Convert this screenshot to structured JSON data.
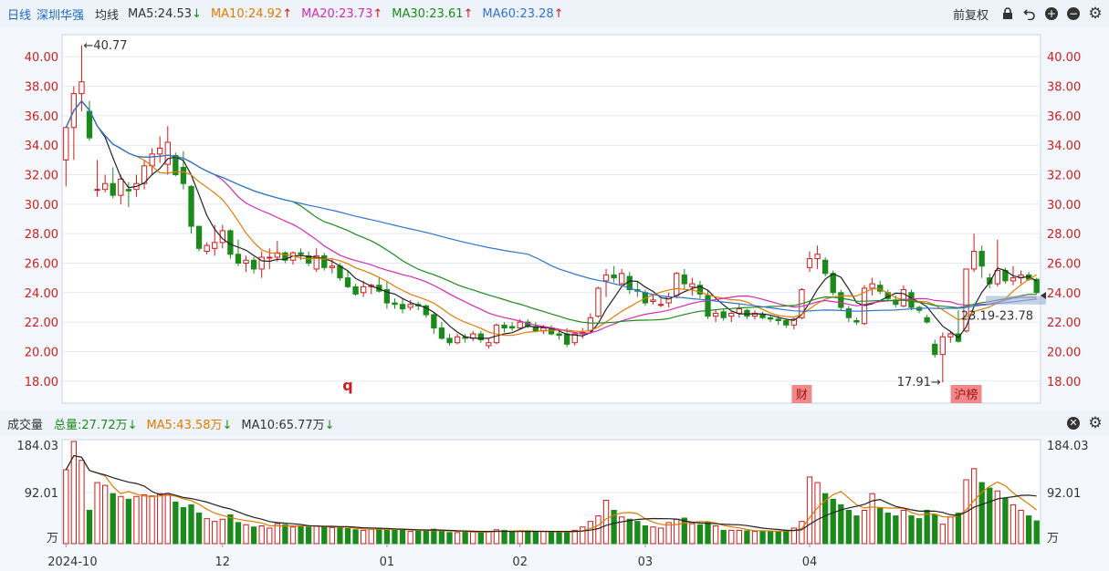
{
  "header": {
    "period": "日线",
    "stock_name": "深圳华强",
    "avg_label": "均线",
    "ma": [
      {
        "text": "MA5:24.53",
        "arrow": "↓",
        "color": "#333333",
        "arrow_color": "#1b8a1b"
      },
      {
        "text": "MA10:24.92",
        "arrow": "↑",
        "color": "#e07b00",
        "arrow_color": "#d11a1a"
      },
      {
        "text": "MA20:23.73",
        "arrow": "↑",
        "color": "#d42bb0",
        "arrow_color": "#d11a1a"
      },
      {
        "text": "MA30:23.61",
        "arrow": "↑",
        "color": "#1b8a1b",
        "arrow_color": "#d11a1a"
      },
      {
        "text": "MA60:23.28",
        "arrow": "↑",
        "color": "#2f74d0",
        "arrow_color": "#d11a1a"
      }
    ],
    "adjust": "前复权",
    "icons": [
      "lock-icon",
      "undo-icon",
      "zoom-in-icon",
      "zoom-out-icon",
      "settings-icon"
    ]
  },
  "price_chart": {
    "y_ticks": [
      "40.00",
      "38.00",
      "36.00",
      "34.00",
      "32.00",
      "30.00",
      "28.00",
      "26.00",
      "24.00",
      "22.00",
      "20.00",
      "18.00"
    ],
    "high_label": "←40.77",
    "low_label": "17.91→",
    "range_label": "23.19-23.78",
    "markers": [
      {
        "text": "q",
        "style": "plain"
      },
      {
        "text": "财",
        "style": "badge"
      },
      {
        "text": "沪榜",
        "style": "badge"
      }
    ]
  },
  "volume_bar": {
    "title": "成交量",
    "total": "总量:27.72万",
    "total_arrow": "↓",
    "ma5": "MA5:43.58万",
    "ma5_arrow": "↓",
    "ma10": "MA10:65.77万",
    "ma10_arrow": "↓",
    "icons": [
      "close-icon",
      "settings-icon"
    ]
  },
  "volume_chart": {
    "y_ticks": [
      "184.03",
      "92.01",
      "万"
    ],
    "x_ticks": [
      "2024-10",
      "12",
      "01",
      "02",
      "03",
      "04"
    ]
  },
  "chart_data": {
    "type": "candlestick",
    "y_range": [
      16.5,
      41.5
    ],
    "volume_range": [
      0,
      184.03
    ],
    "candles": [
      [
        33.0,
        35.2,
        31.2,
        35.2,
        133
      ],
      [
        35.2,
        38.0,
        33.0,
        37.5,
        184
      ],
      [
        37.5,
        40.77,
        36.3,
        38.3,
        150
      ],
      [
        36.3,
        37.0,
        34.3,
        34.5,
        60
      ],
      [
        31.0,
        33.0,
        30.5,
        31.0,
        110
      ],
      [
        31.0,
        32.0,
        30.8,
        31.4,
        105
      ],
      [
        31.4,
        32.5,
        30.4,
        30.6,
        90
      ],
      [
        30.6,
        32.0,
        30.0,
        31.7,
        85
      ],
      [
        31.0,
        31.5,
        29.8,
        30.9,
        80
      ],
      [
        31.0,
        32.0,
        30.5,
        31.4,
        85
      ],
      [
        31.4,
        33.0,
        31.0,
        32.6,
        88
      ],
      [
        32.6,
        33.8,
        32.0,
        33.4,
        86
      ],
      [
        33.4,
        34.6,
        32.8,
        33.8,
        90
      ],
      [
        32.7,
        35.3,
        32.0,
        34.2,
        88
      ],
      [
        33.3,
        33.5,
        31.9,
        32.0,
        75
      ],
      [
        32.5,
        33.6,
        31.0,
        31.4,
        65
      ],
      [
        31.2,
        31.3,
        28.0,
        28.5,
        70
      ],
      [
        28.5,
        28.5,
        26.8,
        27.0,
        55
      ],
      [
        26.8,
        27.4,
        26.6,
        27.2,
        45
      ],
      [
        27.0,
        28.6,
        26.5,
        27.4,
        40
      ],
      [
        27.4,
        28.6,
        27.0,
        28.2,
        44
      ],
      [
        28.2,
        28.3,
        26.3,
        26.6,
        52
      ],
      [
        26.6,
        27.6,
        25.8,
        26.0,
        38
      ],
      [
        26.0,
        26.5,
        25.4,
        26.2,
        34
      ],
      [
        26.2,
        26.4,
        25.3,
        25.6,
        30
      ],
      [
        25.6,
        26.8,
        25.0,
        26.4,
        32
      ],
      [
        26.4,
        27.0,
        25.6,
        26.4,
        28
      ],
      [
        26.4,
        27.5,
        26.1,
        26.7,
        36
      ],
      [
        26.7,
        26.8,
        26.0,
        26.2,
        34
      ],
      [
        26.2,
        26.8,
        25.9,
        26.7,
        30
      ],
      [
        26.7,
        27.0,
        26.2,
        26.6,
        31
      ],
      [
        26.5,
        26.8,
        25.8,
        26.0,
        30
      ],
      [
        25.6,
        27.0,
        25.4,
        26.5,
        32
      ],
      [
        26.5,
        26.7,
        25.5,
        25.7,
        30
      ],
      [
        25.7,
        26.3,
        25.3,
        25.8,
        29
      ],
      [
        25.8,
        26.0,
        24.8,
        25.0,
        28
      ],
      [
        25.0,
        25.5,
        24.3,
        24.4,
        27
      ],
      [
        24.4,
        24.6,
        23.8,
        23.9,
        25
      ],
      [
        24.0,
        24.8,
        23.7,
        24.4,
        24
      ],
      [
        24.4,
        24.6,
        23.9,
        24.5,
        26
      ],
      [
        24.5,
        25.0,
        24.0,
        24.1,
        27
      ],
      [
        24.2,
        24.8,
        22.9,
        23.3,
        26
      ],
      [
        23.3,
        23.6,
        22.9,
        23.2,
        25
      ],
      [
        23.2,
        23.6,
        22.6,
        22.9,
        24
      ],
      [
        23.0,
        23.5,
        22.8,
        23.2,
        22
      ],
      [
        23.2,
        23.4,
        22.8,
        23.1,
        23
      ],
      [
        23.1,
        23.2,
        22.3,
        22.5,
        24
      ],
      [
        22.5,
        22.6,
        21.2,
        21.6,
        26
      ],
      [
        21.6,
        22.0,
        20.8,
        20.9,
        22
      ],
      [
        20.9,
        21.2,
        20.4,
        20.6,
        20
      ],
      [
        20.6,
        21.2,
        20.5,
        21.0,
        20
      ],
      [
        21.0,
        21.2,
        20.6,
        20.9,
        22
      ],
      [
        20.9,
        21.4,
        20.7,
        21.2,
        21
      ],
      [
        21.2,
        21.4,
        20.6,
        20.8,
        20
      ],
      [
        20.4,
        20.9,
        20.2,
        20.6,
        22
      ],
      [
        20.6,
        21.9,
        20.5,
        21.8,
        25
      ],
      [
        21.8,
        22.0,
        21.3,
        21.6,
        24
      ],
      [
        21.7,
        22.0,
        21.4,
        21.6,
        22
      ],
      [
        21.6,
        22.2,
        21.5,
        22.0,
        23
      ],
      [
        22.0,
        22.2,
        21.6,
        21.7,
        22
      ],
      [
        21.7,
        22.0,
        21.3,
        21.4,
        21
      ],
      [
        21.4,
        21.8,
        21.2,
        21.6,
        22
      ],
      [
        21.6,
        21.8,
        21.1,
        21.2,
        20
      ],
      [
        21.2,
        21.5,
        20.8,
        21.1,
        20
      ],
      [
        21.2,
        21.6,
        20.3,
        20.5,
        22
      ],
      [
        20.6,
        21.3,
        20.4,
        21.2,
        24
      ],
      [
        21.2,
        21.6,
        20.9,
        21.3,
        30
      ],
      [
        21.4,
        22.6,
        21.2,
        22.3,
        40
      ],
      [
        22.4,
        24.4,
        22.3,
        24.3,
        50
      ],
      [
        24.8,
        25.6,
        23.7,
        25.2,
        78
      ],
      [
        25.2,
        25.8,
        24.7,
        25.0,
        60
      ],
      [
        24.6,
        25.6,
        24.5,
        25.3,
        48
      ],
      [
        25.1,
        25.4,
        23.9,
        24.2,
        44
      ],
      [
        24.2,
        24.8,
        23.7,
        24.1,
        40
      ],
      [
        24.0,
        24.2,
        23.1,
        23.3,
        32
      ],
      [
        23.4,
        23.9,
        23.2,
        23.5,
        30
      ],
      [
        23.2,
        23.6,
        23.0,
        23.2,
        28
      ],
      [
        23.3,
        24.0,
        23.0,
        23.7,
        38
      ],
      [
        23.8,
        25.4,
        23.6,
        25.3,
        44
      ],
      [
        25.2,
        25.6,
        24.2,
        24.6,
        46
      ],
      [
        24.4,
        25.0,
        23.8,
        24.6,
        36
      ],
      [
        24.5,
        24.8,
        23.6,
        23.9,
        34
      ],
      [
        23.8,
        24.2,
        22.2,
        22.4,
        38
      ],
      [
        22.4,
        22.8,
        22.0,
        22.6,
        32
      ],
      [
        22.7,
        22.9,
        22.1,
        22.3,
        24
      ],
      [
        22.4,
        22.7,
        22.0,
        22.6,
        24
      ],
      [
        22.6,
        23.2,
        22.3,
        22.9,
        24
      ],
      [
        22.8,
        22.9,
        22.2,
        22.4,
        23
      ],
      [
        22.4,
        22.8,
        22.2,
        22.6,
        22
      ],
      [
        22.5,
        22.7,
        22.2,
        22.3,
        23
      ],
      [
        22.3,
        22.5,
        22.0,
        22.2,
        22
      ],
      [
        22.2,
        22.4,
        21.8,
        22.1,
        22
      ],
      [
        22.1,
        22.2,
        21.6,
        21.8,
        24
      ],
      [
        21.8,
        22.3,
        21.5,
        22.2,
        28
      ],
      [
        22.3,
        24.3,
        22.2,
        24.2,
        40
      ],
      [
        25.7,
        26.8,
        25.4,
        26.3,
        120
      ],
      [
        26.3,
        27.2,
        25.6,
        26.6,
        110
      ],
      [
        26.2,
        26.4,
        25.1,
        25.3,
        90
      ],
      [
        25.3,
        25.5,
        23.8,
        24.0,
        80
      ],
      [
        24.0,
        24.2,
        22.8,
        23.0,
        70
      ],
      [
        22.9,
        23.1,
        22.0,
        22.3,
        60
      ],
      [
        22.1,
        22.3,
        21.8,
        22.0,
        50
      ],
      [
        21.9,
        24.5,
        21.8,
        24.3,
        60
      ],
      [
        24.3,
        25.0,
        23.8,
        24.6,
        90
      ],
      [
        24.5,
        24.8,
        23.9,
        24.1,
        65
      ],
      [
        24.0,
        24.2,
        23.4,
        23.6,
        55
      ],
      [
        23.5,
        23.8,
        23.0,
        23.2,
        50
      ],
      [
        23.1,
        24.5,
        23.0,
        24.2,
        60
      ],
      [
        24.0,
        24.2,
        22.8,
        23.0,
        50
      ],
      [
        23.0,
        23.1,
        22.6,
        22.8,
        45
      ],
      [
        22.3,
        22.5,
        21.9,
        22.0,
        60
      ],
      [
        20.5,
        20.8,
        19.6,
        19.8,
        52
      ],
      [
        19.8,
        21.3,
        17.91,
        21.0,
        35
      ],
      [
        21.0,
        21.4,
        20.6,
        21.2,
        48
      ],
      [
        21.2,
        22.8,
        20.6,
        20.7,
        55
      ],
      [
        21.4,
        25.6,
        21.3,
        25.6,
        115
      ],
      [
        25.6,
        28.0,
        25.4,
        26.8,
        135
      ],
      [
        26.8,
        27.2,
        25.0,
        25.8,
        110
      ],
      [
        25.0,
        25.3,
        24.3,
        24.6,
        100
      ],
      [
        24.6,
        27.6,
        24.4,
        25.5,
        95
      ],
      [
        25.5,
        25.7,
        24.6,
        24.8,
        82
      ],
      [
        24.8,
        25.8,
        24.5,
        25.0,
        70
      ],
      [
        25.0,
        25.5,
        24.6,
        25.2,
        60
      ],
      [
        25.2,
        25.4,
        24.8,
        24.9,
        50
      ],
      [
        24.9,
        25.0,
        23.9,
        24.0,
        41
      ]
    ]
  }
}
